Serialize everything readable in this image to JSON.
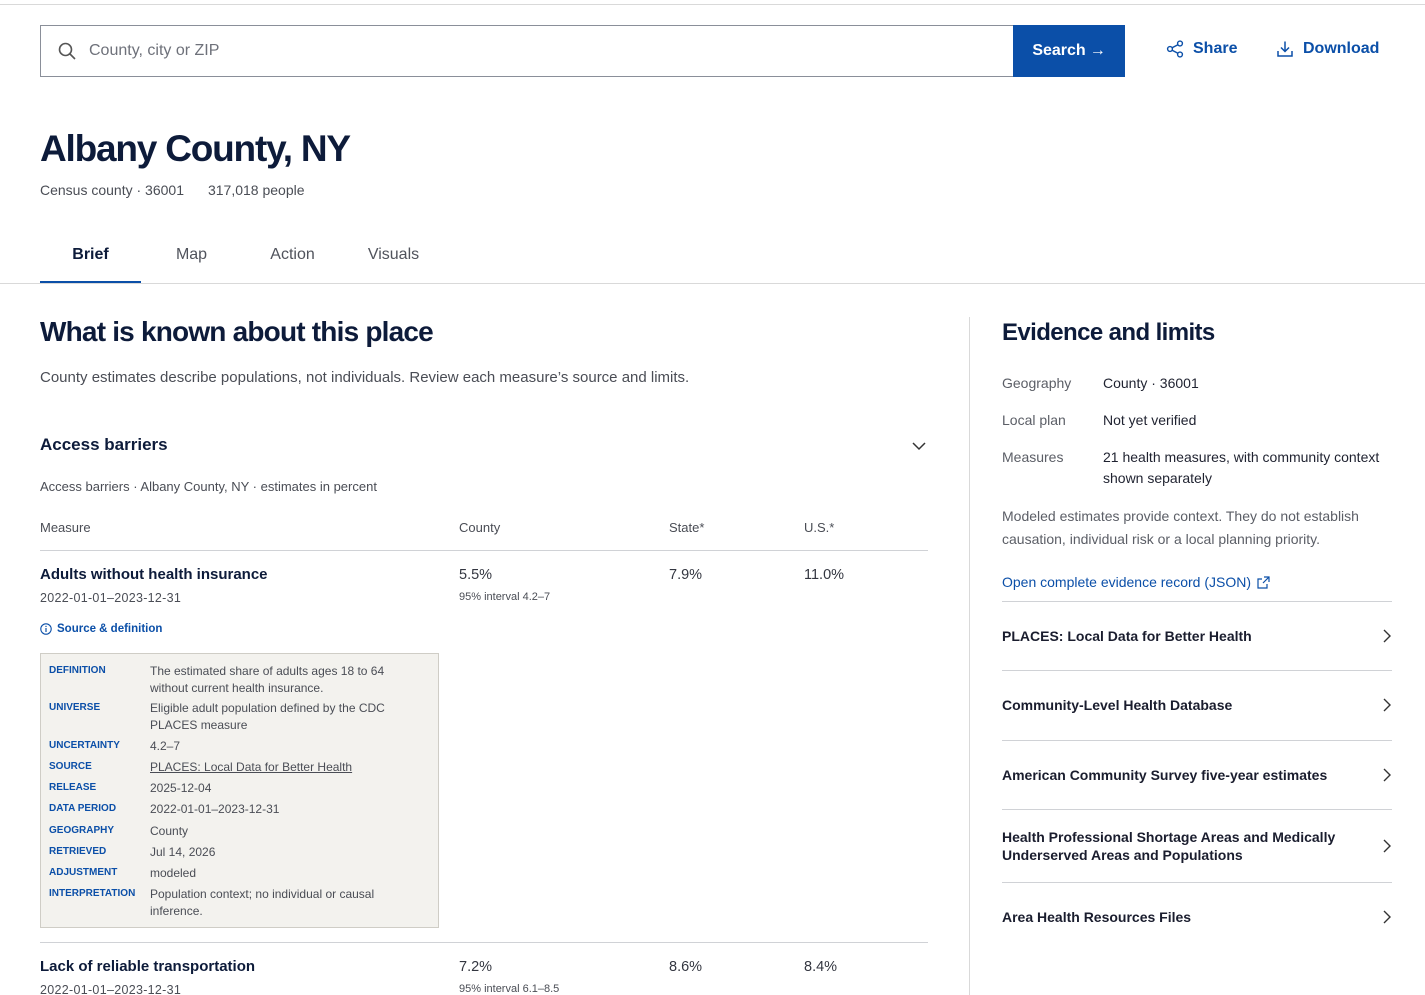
{
  "search": {
    "placeholder": "County, city or ZIP",
    "button_label": "Search",
    "button_arrow": "→"
  },
  "header_actions": {
    "share_label": "Share",
    "download_label": "Download"
  },
  "place": {
    "title": "Albany County, NY",
    "type_code": "Census county · 36001",
    "population": "317,018 people"
  },
  "tabs": [
    {
      "label": "Brief",
      "active": true
    },
    {
      "label": "Map",
      "active": false
    },
    {
      "label": "Action",
      "active": false
    },
    {
      "label": "Visuals",
      "active": false
    }
  ],
  "main": {
    "heading": "What is known about this place",
    "intro": "County estimates describe populations, not individuals. Review each measure’s source and limits.",
    "section": {
      "title": "Access barriers",
      "caption": "Access barriers · Albany County, NY · estimates in percent",
      "columns": {
        "measure": "Measure",
        "county": "County",
        "state": "State*",
        "us": "U.S.*"
      },
      "rows": [
        {
          "name": "Adults without health insurance",
          "period": "2022-01-01–2023-12-31",
          "county": "5.5%",
          "interval": "95% interval 4.2–7",
          "state": "7.9%",
          "us": "11.0%"
        },
        {
          "name": "Lack of reliable transportation",
          "period": "2022-01-01–2023-12-31",
          "county": "7.2%",
          "interval": "95% interval 6.1–8.5",
          "state": "8.6%",
          "us": "8.4%"
        }
      ],
      "source_link": "Source & definition",
      "definition": {
        "definition_key": "DEFINITION",
        "definition_val": "The estimated share of adults ages 18 to 64 without current health insurance.",
        "universe_key": "UNIVERSE",
        "universe_val": "Eligible adult population defined by the CDC PLACES measure",
        "uncertainty_key": "UNCERTAINTY",
        "uncertainty_val": "4.2–7",
        "source_key": "SOURCE",
        "source_val": "PLACES: Local Data for Better Health",
        "release_key": "RELEASE",
        "release_val": "2025-12-04",
        "period_key": "DATA PERIOD",
        "period_val": "2022-01-01–2023-12-31",
        "geography_key": "GEOGRAPHY",
        "geography_val": "County",
        "retrieved_key": "RETRIEVED",
        "retrieved_val": "Jul 14, 2026",
        "adjustment_key": "ADJUSTMENT",
        "adjustment_val": "modeled",
        "interpretation_key": "INTERPRETATION",
        "interpretation_val": "Population context; no individual or causal inference."
      }
    }
  },
  "evidence": {
    "heading": "Evidence and limits",
    "geography_label": "Geography",
    "geography_value": "County · 36001",
    "plan_label": "Local plan",
    "plan_value": "Not yet verified",
    "measures_label": "Measures",
    "measures_value": "21 health measures, with community context shown separately",
    "note": "Modeled estimates provide context. They do not establish causation, individual risk or a local planning priority.",
    "json_link": "Open complete evidence record (JSON)",
    "sources": [
      "PLACES: Local Data for Better Health",
      "Community-Level Health Database",
      "American Community Survey five-year estimates",
      "Health Professional Shortage Areas and Medically Underserved Areas and Populations",
      "Area Health Resources Files"
    ]
  },
  "colors": {
    "accent": "#0b4fa8",
    "heading": "#0d1b3a",
    "definition_bg": "#f3f2ee"
  }
}
